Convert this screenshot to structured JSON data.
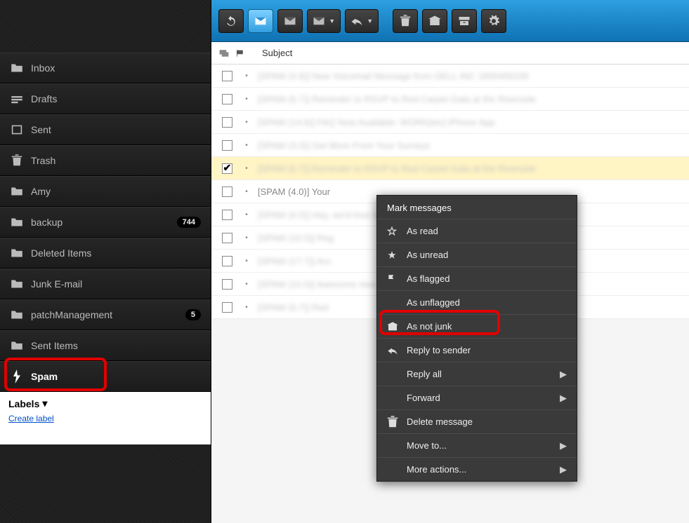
{
  "sidebar": {
    "folders": [
      {
        "icon": "folder",
        "label": "Inbox",
        "badge": null,
        "selected": false
      },
      {
        "icon": "drafts",
        "label": "Drafts",
        "badge": null,
        "selected": false
      },
      {
        "icon": "sent",
        "label": "Sent",
        "badge": null,
        "selected": false
      },
      {
        "icon": "trash",
        "label": "Trash",
        "badge": null,
        "selected": false
      },
      {
        "icon": "folder",
        "label": "Amy",
        "badge": null,
        "selected": false
      },
      {
        "icon": "folder",
        "label": "backup",
        "badge": "744",
        "selected": false
      },
      {
        "icon": "folder",
        "label": "Deleted Items",
        "badge": null,
        "selected": false
      },
      {
        "icon": "folder",
        "label": "Junk E-mail",
        "badge": null,
        "selected": false
      },
      {
        "icon": "folder",
        "label": "patchManagement",
        "badge": "5",
        "selected": false
      },
      {
        "icon": "folder",
        "label": "Sent Items",
        "badge": null,
        "selected": false
      },
      {
        "icon": "spam",
        "label": "Spam",
        "badge": null,
        "selected": true
      }
    ],
    "labels_header": "Labels",
    "create_label": "Create label"
  },
  "list": {
    "header_subject": "Subject",
    "rows": [
      {
        "checked": false,
        "selected": false,
        "blurred": true,
        "subject": "[SPAM (4.8)] New Voicemail Message from DELL INC 1800456335"
      },
      {
        "checked": false,
        "selected": false,
        "blurred": true,
        "subject": "[SPAM (6.7)] Reminder to RSVP to Red Carpet Gala at the Riverside"
      },
      {
        "checked": false,
        "selected": false,
        "blurred": true,
        "subject": "[SPAM (14.6)] FAQ Now Available: WORK[etc] iPhone App"
      },
      {
        "checked": false,
        "selected": false,
        "blurred": true,
        "subject": "[SPAM (3.0)] Get More From Your Surveys"
      },
      {
        "checked": true,
        "selected": true,
        "blurred": true,
        "subject": "[SPAM (6.7)] Reminder to RSVP to Red Carpet Gala at the Riverside"
      },
      {
        "checked": false,
        "selected": false,
        "blurred": false,
        "subject": "[SPAM (4.0)] Your"
      },
      {
        "checked": false,
        "selected": false,
        "blurred": true,
        "subject": "[SPAM (4.0)] Hey, we'd love to hear your Netflix survey results"
      },
      {
        "checked": false,
        "selected": false,
        "blurred": true,
        "subject": "[SPAM (10.5)] Reg"
      },
      {
        "checked": false,
        "selected": false,
        "blurred": true,
        "subject": "[SPAM (17.7)] Acc"
      },
      {
        "checked": false,
        "selected": false,
        "blurred": true,
        "subject": "[SPAM (10.0)] Awesome new deals on tech & gadgets"
      },
      {
        "checked": false,
        "selected": false,
        "blurred": true,
        "subject": "[SPAM (6.7)] Red"
      }
    ]
  },
  "menu": {
    "header": "Mark messages",
    "items": [
      {
        "label": "As read",
        "icon": "star-outline",
        "arrow": false
      },
      {
        "label": "As unread",
        "icon": "star-solid",
        "arrow": false
      },
      {
        "label": "As flagged",
        "icon": "flag",
        "arrow": false
      },
      {
        "label": "As unflagged",
        "icon": "",
        "arrow": false
      },
      {
        "label": "As not junk",
        "icon": "notjunk",
        "arrow": false
      },
      {
        "label": "Reply to sender",
        "icon": "reply",
        "arrow": false
      },
      {
        "label": "Reply all",
        "icon": "",
        "arrow": true
      },
      {
        "label": "Forward",
        "icon": "",
        "arrow": true
      },
      {
        "label": "Delete message",
        "icon": "trash",
        "arrow": false
      },
      {
        "label": "Move to...",
        "icon": "",
        "arrow": true
      },
      {
        "label": "More actions...",
        "icon": "",
        "arrow": true
      }
    ]
  }
}
